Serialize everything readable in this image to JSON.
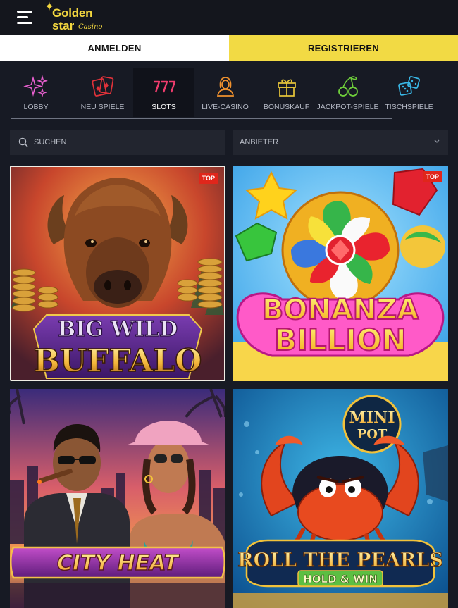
{
  "header": {
    "logo_line1": "Golden",
    "logo_line2": "star",
    "logo_line3": "Casino"
  },
  "auth": {
    "login_label": "ANMELDEN",
    "register_label": "REGISTRIEREN"
  },
  "nav": {
    "items": [
      {
        "label": "LOBBY",
        "icon": "sparkles-icon"
      },
      {
        "label": "NEU SPIELE",
        "icon": "playing-cards-icon"
      },
      {
        "label": "SLOTS",
        "icon": "slot-777-icon"
      },
      {
        "label": "LIVE-CASINO",
        "icon": "dealer-icon"
      },
      {
        "label": "BONUSKAUF",
        "icon": "gift-icon"
      },
      {
        "label": "JACKPOT-SPIELE",
        "icon": "cherries-icon"
      },
      {
        "label": "TISCHSPIELE",
        "icon": "dice-icon"
      }
    ],
    "active": "SLOTS"
  },
  "filters": {
    "search_placeholder": "SUCHEN",
    "provider_label": "ANBIETER"
  },
  "games": [
    {
      "title_line1": "BIG WILD",
      "title_line2": "BUFFALO",
      "badge": "TOP"
    },
    {
      "title_line1": "BONANZA",
      "title_line2": "BILLION",
      "badge": "TOP"
    },
    {
      "title_line1": "CITY HEAT"
    },
    {
      "title_line1": "ROLL THE PEARLS",
      "title_line2": "HOLD & WIN",
      "corner_badge_line1": "MINI",
      "corner_badge_line2": "POT"
    }
  ],
  "colors": {
    "background": "#171a24",
    "accent_yellow": "#f2da44",
    "badge_red": "#e0261b"
  }
}
